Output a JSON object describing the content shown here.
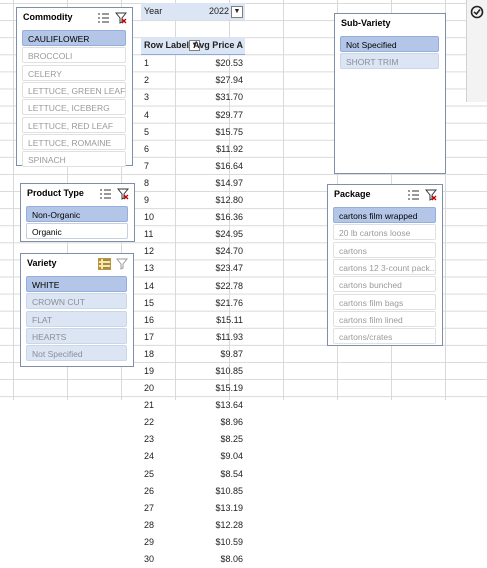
{
  "pivot": {
    "filter_label": "Year",
    "filter_value": "2022",
    "header_rows": "Row Labels",
    "header_value": "Avg Price A",
    "rows": [
      {
        "label": "1",
        "value": "$20.53"
      },
      {
        "label": "2",
        "value": "$27.94"
      },
      {
        "label": "3",
        "value": "$31.70"
      },
      {
        "label": "4",
        "value": "$29.77"
      },
      {
        "label": "5",
        "value": "$15.75"
      },
      {
        "label": "6",
        "value": "$11.92"
      },
      {
        "label": "7",
        "value": "$16.64"
      },
      {
        "label": "8",
        "value": "$14.97"
      },
      {
        "label": "9",
        "value": "$12.80"
      },
      {
        "label": "10",
        "value": "$16.36"
      },
      {
        "label": "11",
        "value": "$24.95"
      },
      {
        "label": "12",
        "value": "$24.70"
      },
      {
        "label": "13",
        "value": "$23.47"
      },
      {
        "label": "14",
        "value": "$22.78"
      },
      {
        "label": "15",
        "value": "$21.76"
      },
      {
        "label": "16",
        "value": "$15.11"
      },
      {
        "label": "17",
        "value": "$11.93"
      },
      {
        "label": "18",
        "value": "$9.87"
      },
      {
        "label": "19",
        "value": "$10.85"
      },
      {
        "label": "20",
        "value": "$15.19"
      },
      {
        "label": "21",
        "value": "$13.64"
      },
      {
        "label": "22",
        "value": "$8.96"
      },
      {
        "label": "23",
        "value": "$8.25"
      },
      {
        "label": "24",
        "value": "$9.04"
      },
      {
        "label": "25",
        "value": "$8.54"
      },
      {
        "label": "26",
        "value": "$10.85"
      },
      {
        "label": "27",
        "value": "$13.19"
      },
      {
        "label": "28",
        "value": "$12.28"
      },
      {
        "label": "29",
        "value": "$10.59"
      },
      {
        "label": "30",
        "value": "$8.06"
      }
    ]
  },
  "slicers": {
    "commodity": {
      "title": "Commodity",
      "items": [
        "CAULIFLOWER",
        "BROCCOLI",
        "CELERY",
        "LETTUCE, GREEN LEAF",
        "LETTUCE, ICEBERG",
        "LETTUCE, RED LEAF",
        "LETTUCE, ROMAINE",
        "SPINACH"
      ]
    },
    "product_type": {
      "title": "Product Type",
      "items": [
        "Non-Organic",
        "Organic"
      ]
    },
    "variety": {
      "title": "Variety",
      "items": [
        "WHITE",
        "CROWN CUT",
        "FLAT",
        "HEARTS",
        "Not Specified"
      ]
    },
    "sub_variety": {
      "title": "Sub-Variety",
      "items": [
        "Not Specified",
        "SHORT TRIM"
      ]
    },
    "package": {
      "title": "Package",
      "items": [
        "cartons film wrapped",
        "20 lb cartons loose",
        "cartons",
        "cartons 12 3-count pack...",
        "cartons bunched",
        "cartons film bags",
        "cartons film lined",
        "cartons/crates"
      ]
    }
  },
  "colors": {
    "selected": "#b4c6e7",
    "header": "#dbe5f3",
    "grid": "#d9d9d9"
  },
  "icons": {
    "multiselect": "multi-select-icon",
    "clear_filter": "clear-filter-icon",
    "filter_dropdown": "filter-dropdown-icon"
  }
}
